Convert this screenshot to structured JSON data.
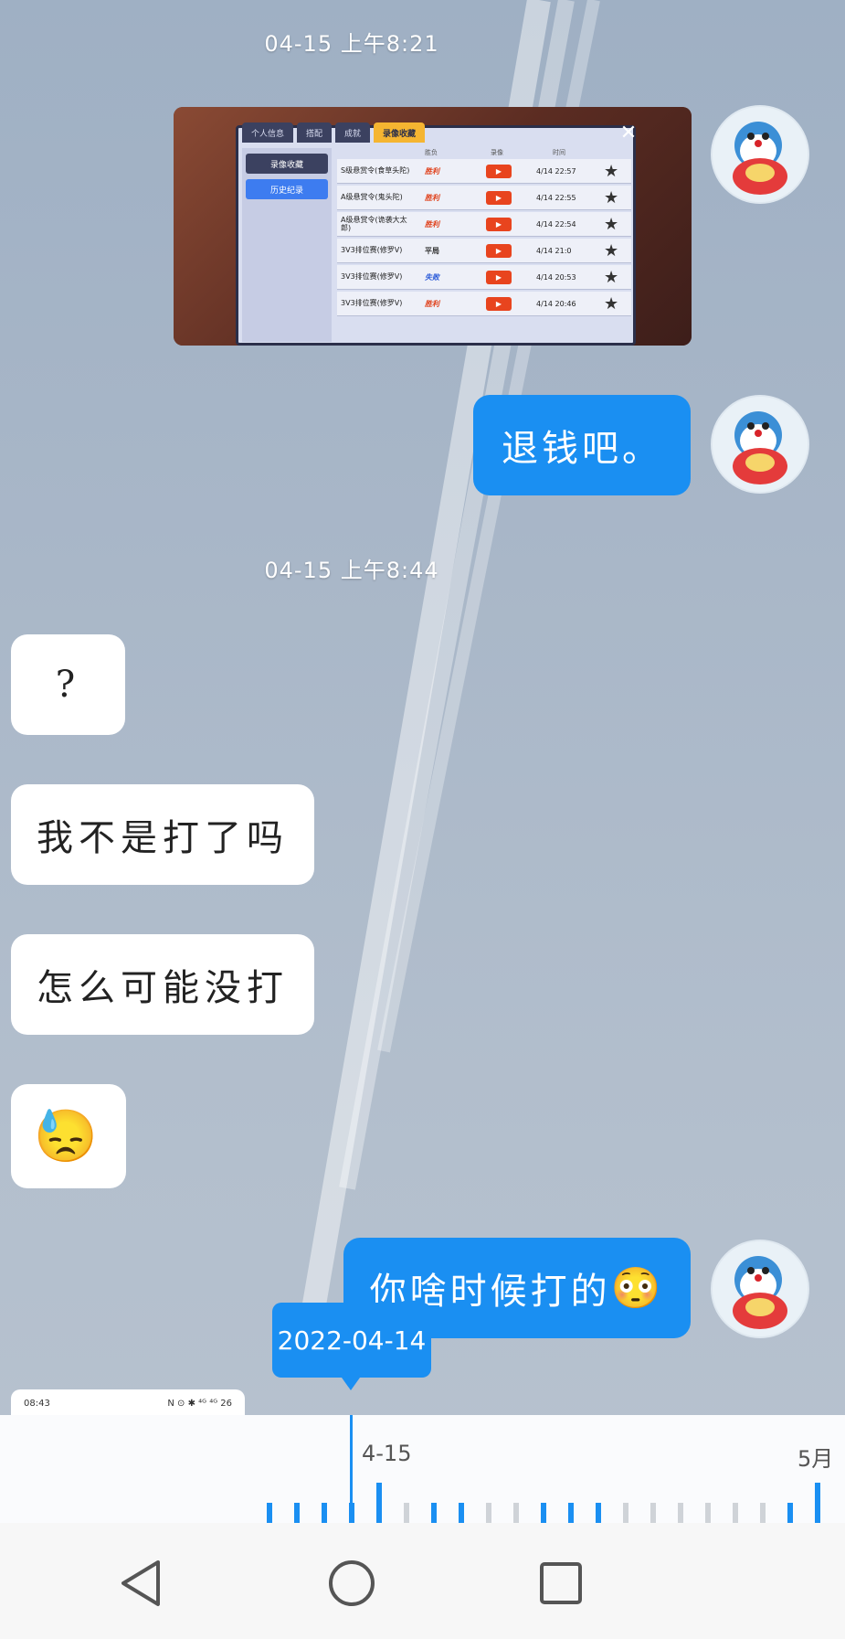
{
  "messages": {
    "timestamp_1": "04-15  上午8:21",
    "timestamp_2": "04-15  上午8:44",
    "out_1": "退钱吧。",
    "in_1": "?",
    "in_2": "我不是打了吗",
    "in_3": "怎么可能没打",
    "in_4_emoji": "😓",
    "out_2": "你啥时候打的",
    "out_2_emoji": "😳"
  },
  "game_screenshot": {
    "tabs": [
      "个人信息",
      "搭配",
      "成就",
      "录像收藏"
    ],
    "side_buttons": [
      "录像收藏",
      "历史纪录"
    ],
    "col_result": "胜负",
    "col_video": "录像",
    "col_time": "时间",
    "play_label": "▶",
    "star": "★",
    "close": "✕",
    "rows": [
      {
        "name": "S级悬赏令(食草头陀)",
        "result": "胜利",
        "result_type": "win",
        "time": "4/14 22:57"
      },
      {
        "name": "A级悬赏令(鬼头陀)",
        "result": "胜利",
        "result_type": "win",
        "time": "4/14 22:55"
      },
      {
        "name": "A级悬赏令(诡袭大太郎)",
        "result": "胜利",
        "result_type": "win",
        "time": "4/14 22:54"
      },
      {
        "name": "3V3排位赛(修罗V)",
        "result": "平局",
        "result_type": "draw",
        "time": "4/14 21:0"
      },
      {
        "name": "3V3排位赛(修罗V)",
        "result": "失败",
        "result_type": "lose",
        "time": "4/14 20:53"
      },
      {
        "name": "3V3排位赛(修罗V)",
        "result": "胜利",
        "result_type": "win",
        "time": "4/14 20:46"
      }
    ]
  },
  "date_popup": "2022-04-14",
  "mini_card": {
    "time": "08:43",
    "status": "N ⊙ ✱ ⁴ᴳ ⁴ᴳ 26"
  },
  "timeline": {
    "label_current": "4-15",
    "label_next": "5月"
  },
  "icons": {
    "back": "back-icon",
    "home": "home-icon",
    "recents": "recents-icon"
  },
  "colors": {
    "accent": "#1a8ff2",
    "bubble_in": "#ffffff",
    "nav_bg": "#f7f7f7"
  }
}
